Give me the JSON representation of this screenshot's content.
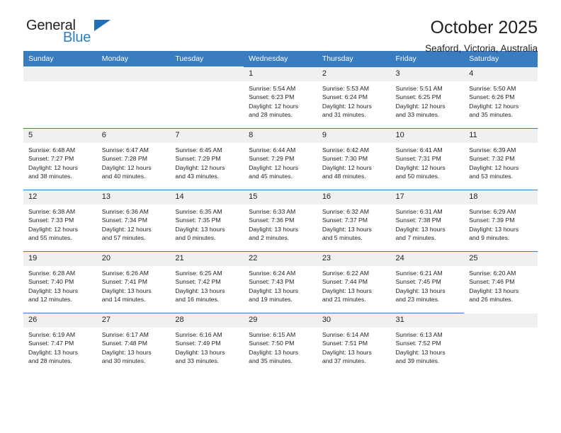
{
  "brand": {
    "name_part1": "General",
    "name_part2": "Blue",
    "triangle_color": "#1f6fb8",
    "blue_color": "#2b7cc4"
  },
  "header": {
    "month_title": "October 2025",
    "location": "Seaford, Victoria, Australia"
  },
  "theme": {
    "header_row_bg": "#3a7cc0",
    "daynum_bg": "#f0f0f0",
    "text_color": "#231f20"
  },
  "weekdays": [
    "Sunday",
    "Monday",
    "Tuesday",
    "Wednesday",
    "Thursday",
    "Friday",
    "Saturday"
  ],
  "labels": {
    "sunrise": "Sunrise:",
    "sunset": "Sunset:",
    "daylight": "Daylight:"
  },
  "weeks": [
    [
      {
        "day": "",
        "empty": true
      },
      {
        "day": "",
        "empty": true
      },
      {
        "day": "",
        "empty": true
      },
      {
        "day": "1",
        "sunrise": "Sunrise: 5:54 AM",
        "sunset": "Sunset: 6:23 PM",
        "daylight1": "Daylight: 12 hours",
        "daylight2": "and 28 minutes."
      },
      {
        "day": "2",
        "sunrise": "Sunrise: 5:53 AM",
        "sunset": "Sunset: 6:24 PM",
        "daylight1": "Daylight: 12 hours",
        "daylight2": "and 31 minutes."
      },
      {
        "day": "3",
        "sunrise": "Sunrise: 5:51 AM",
        "sunset": "Sunset: 6:25 PM",
        "daylight1": "Daylight: 12 hours",
        "daylight2": "and 33 minutes."
      },
      {
        "day": "4",
        "sunrise": "Sunrise: 5:50 AM",
        "sunset": "Sunset: 6:26 PM",
        "daylight1": "Daylight: 12 hours",
        "daylight2": "and 35 minutes."
      }
    ],
    [
      {
        "day": "5",
        "sunrise": "Sunrise: 6:48 AM",
        "sunset": "Sunset: 7:27 PM",
        "daylight1": "Daylight: 12 hours",
        "daylight2": "and 38 minutes."
      },
      {
        "day": "6",
        "sunrise": "Sunrise: 6:47 AM",
        "sunset": "Sunset: 7:28 PM",
        "daylight1": "Daylight: 12 hours",
        "daylight2": "and 40 minutes."
      },
      {
        "day": "7",
        "sunrise": "Sunrise: 6:45 AM",
        "sunset": "Sunset: 7:29 PM",
        "daylight1": "Daylight: 12 hours",
        "daylight2": "and 43 minutes."
      },
      {
        "day": "8",
        "sunrise": "Sunrise: 6:44 AM",
        "sunset": "Sunset: 7:29 PM",
        "daylight1": "Daylight: 12 hours",
        "daylight2": "and 45 minutes."
      },
      {
        "day": "9",
        "sunrise": "Sunrise: 6:42 AM",
        "sunset": "Sunset: 7:30 PM",
        "daylight1": "Daylight: 12 hours",
        "daylight2": "and 48 minutes."
      },
      {
        "day": "10",
        "sunrise": "Sunrise: 6:41 AM",
        "sunset": "Sunset: 7:31 PM",
        "daylight1": "Daylight: 12 hours",
        "daylight2": "and 50 minutes."
      },
      {
        "day": "11",
        "sunrise": "Sunrise: 6:39 AM",
        "sunset": "Sunset: 7:32 PM",
        "daylight1": "Daylight: 12 hours",
        "daylight2": "and 53 minutes."
      }
    ],
    [
      {
        "day": "12",
        "sunrise": "Sunrise: 6:38 AM",
        "sunset": "Sunset: 7:33 PM",
        "daylight1": "Daylight: 12 hours",
        "daylight2": "and 55 minutes."
      },
      {
        "day": "13",
        "sunrise": "Sunrise: 6:36 AM",
        "sunset": "Sunset: 7:34 PM",
        "daylight1": "Daylight: 12 hours",
        "daylight2": "and 57 minutes."
      },
      {
        "day": "14",
        "sunrise": "Sunrise: 6:35 AM",
        "sunset": "Sunset: 7:35 PM",
        "daylight1": "Daylight: 13 hours",
        "daylight2": "and 0 minutes."
      },
      {
        "day": "15",
        "sunrise": "Sunrise: 6:33 AM",
        "sunset": "Sunset: 7:36 PM",
        "daylight1": "Daylight: 13 hours",
        "daylight2": "and 2 minutes."
      },
      {
        "day": "16",
        "sunrise": "Sunrise: 6:32 AM",
        "sunset": "Sunset: 7:37 PM",
        "daylight1": "Daylight: 13 hours",
        "daylight2": "and 5 minutes."
      },
      {
        "day": "17",
        "sunrise": "Sunrise: 6:31 AM",
        "sunset": "Sunset: 7:38 PM",
        "daylight1": "Daylight: 13 hours",
        "daylight2": "and 7 minutes."
      },
      {
        "day": "18",
        "sunrise": "Sunrise: 6:29 AM",
        "sunset": "Sunset: 7:39 PM",
        "daylight1": "Daylight: 13 hours",
        "daylight2": "and 9 minutes."
      }
    ],
    [
      {
        "day": "19",
        "sunrise": "Sunrise: 6:28 AM",
        "sunset": "Sunset: 7:40 PM",
        "daylight1": "Daylight: 13 hours",
        "daylight2": "and 12 minutes."
      },
      {
        "day": "20",
        "sunrise": "Sunrise: 6:26 AM",
        "sunset": "Sunset: 7:41 PM",
        "daylight1": "Daylight: 13 hours",
        "daylight2": "and 14 minutes."
      },
      {
        "day": "21",
        "sunrise": "Sunrise: 6:25 AM",
        "sunset": "Sunset: 7:42 PM",
        "daylight1": "Daylight: 13 hours",
        "daylight2": "and 16 minutes."
      },
      {
        "day": "22",
        "sunrise": "Sunrise: 6:24 AM",
        "sunset": "Sunset: 7:43 PM",
        "daylight1": "Daylight: 13 hours",
        "daylight2": "and 19 minutes."
      },
      {
        "day": "23",
        "sunrise": "Sunrise: 6:22 AM",
        "sunset": "Sunset: 7:44 PM",
        "daylight1": "Daylight: 13 hours",
        "daylight2": "and 21 minutes."
      },
      {
        "day": "24",
        "sunrise": "Sunrise: 6:21 AM",
        "sunset": "Sunset: 7:45 PM",
        "daylight1": "Daylight: 13 hours",
        "daylight2": "and 23 minutes."
      },
      {
        "day": "25",
        "sunrise": "Sunrise: 6:20 AM",
        "sunset": "Sunset: 7:46 PM",
        "daylight1": "Daylight: 13 hours",
        "daylight2": "and 26 minutes."
      }
    ],
    [
      {
        "day": "26",
        "sunrise": "Sunrise: 6:19 AM",
        "sunset": "Sunset: 7:47 PM",
        "daylight1": "Daylight: 13 hours",
        "daylight2": "and 28 minutes."
      },
      {
        "day": "27",
        "sunrise": "Sunrise: 6:17 AM",
        "sunset": "Sunset: 7:48 PM",
        "daylight1": "Daylight: 13 hours",
        "daylight2": "and 30 minutes."
      },
      {
        "day": "28",
        "sunrise": "Sunrise: 6:16 AM",
        "sunset": "Sunset: 7:49 PM",
        "daylight1": "Daylight: 13 hours",
        "daylight2": "and 33 minutes."
      },
      {
        "day": "29",
        "sunrise": "Sunrise: 6:15 AM",
        "sunset": "Sunset: 7:50 PM",
        "daylight1": "Daylight: 13 hours",
        "daylight2": "and 35 minutes."
      },
      {
        "day": "30",
        "sunrise": "Sunrise: 6:14 AM",
        "sunset": "Sunset: 7:51 PM",
        "daylight1": "Daylight: 13 hours",
        "daylight2": "and 37 minutes."
      },
      {
        "day": "31",
        "sunrise": "Sunrise: 6:13 AM",
        "sunset": "Sunset: 7:52 PM",
        "daylight1": "Daylight: 13 hours",
        "daylight2": "and 39 minutes."
      },
      {
        "day": "",
        "empty": true
      }
    ]
  ]
}
